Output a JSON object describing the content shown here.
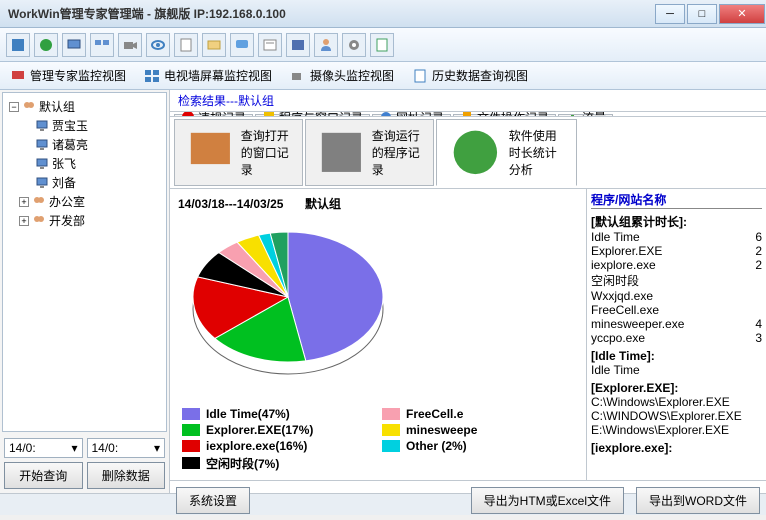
{
  "window": {
    "title": "WorkWin管理专家管理端 - 旗舰版 IP:192.168.0.100"
  },
  "viewtabs": [
    {
      "label": "管理专家监控视图"
    },
    {
      "label": "电视墙屏幕监控视图"
    },
    {
      "label": "摄像头监控视图"
    },
    {
      "label": "历史数据查询视图"
    }
  ],
  "tree": {
    "root_label": "默认组",
    "children": [
      {
        "label": "贾宝玉"
      },
      {
        "label": "诸葛亮"
      },
      {
        "label": "张飞"
      },
      {
        "label": "刘备"
      }
    ],
    "siblings": [
      {
        "label": "办公室"
      },
      {
        "label": "开发部"
      }
    ]
  },
  "dates": {
    "from": "14/0:",
    "to": "14/0:"
  },
  "btns": {
    "start": "开始查询",
    "delete": "删除数据"
  },
  "search_result": "检索结果---默认组",
  "rectabs": [
    {
      "label": "违规记录"
    },
    {
      "label": "程序与窗口记录"
    },
    {
      "label": "网址记录"
    },
    {
      "label": "文件操作记录"
    },
    {
      "label": "流量"
    }
  ],
  "subtabs": [
    {
      "label": "查询打开的窗口记录"
    },
    {
      "label": "查询运行的程序记录"
    },
    {
      "label": "软件使用时长统计分析"
    }
  ],
  "chart_title_range": "14/03/18---14/03/25",
  "chart_title_group": "默认组",
  "chart_data": {
    "type": "pie",
    "title": "14/03/18---14/03/25 默认组",
    "series": [
      {
        "name": "Idle Time",
        "value": 47,
        "color": "#7a6fe8"
      },
      {
        "name": "Explorer.EXE",
        "value": 17,
        "color": "#00c020"
      },
      {
        "name": "iexplore.exe",
        "value": 16,
        "color": "#e00000"
      },
      {
        "name": "空闲时段",
        "value": 7,
        "color": "#000000"
      },
      {
        "name": "FreeCell.exe",
        "value": 4,
        "color": "#f8a0b0",
        "legend_label": "FreeCell.e"
      },
      {
        "name": "minesweeper.exe",
        "value": 4,
        "color": "#f8e000",
        "legend_label": "minesweepe"
      },
      {
        "name": "Other",
        "value": 2,
        "color": "#00d0e0",
        "legend_label": "Other (2%)"
      },
      {
        "name": "yccpo.exe",
        "value": 3,
        "color": "#20a060"
      }
    ],
    "legend_left": [
      "Idle Time(47%)",
      "Explorer.EXE(17%)",
      "iexplore.exe(16%)",
      "空闲时段(7%)"
    ],
    "legend_right": [
      "FreeCell.e",
      "minesweepe",
      "Other (2%)"
    ]
  },
  "proglist": {
    "header": "程序/网站名称",
    "sections": [
      {
        "title": "[默认组累计时长]:",
        "rows": [
          {
            "name": "Idle Time",
            "val": "6"
          },
          {
            "name": "Explorer.EXE",
            "val": "2"
          },
          {
            "name": "iexplore.exe",
            "val": "2"
          },
          {
            "name": "空闲时段",
            "val": ""
          },
          {
            "name": "Wxxjqd.exe",
            "val": ""
          },
          {
            "name": "FreeCell.exe",
            "val": ""
          },
          {
            "name": "minesweeper.exe",
            "val": "4"
          },
          {
            "name": "yccpo.exe",
            "val": "3"
          }
        ]
      },
      {
        "title": "[Idle Time]:",
        "rows": [
          {
            "name": "Idle Time",
            "val": ""
          }
        ]
      },
      {
        "title": "[Explorer.EXE]:",
        "rows": [
          {
            "name": "C:\\Windows\\Explorer.EXE",
            "val": ""
          },
          {
            "name": "C:\\WINDOWS\\Explorer.EXE",
            "val": ""
          },
          {
            "name": "E:\\Windows\\Explorer.EXE",
            "val": ""
          }
        ]
      },
      {
        "title": "[iexplore.exe]:",
        "rows": []
      }
    ]
  },
  "footbtns": {
    "settings": "系统设置",
    "export_html": "导出为HTM或Excel文件",
    "export_word": "导出到WORD文件"
  }
}
